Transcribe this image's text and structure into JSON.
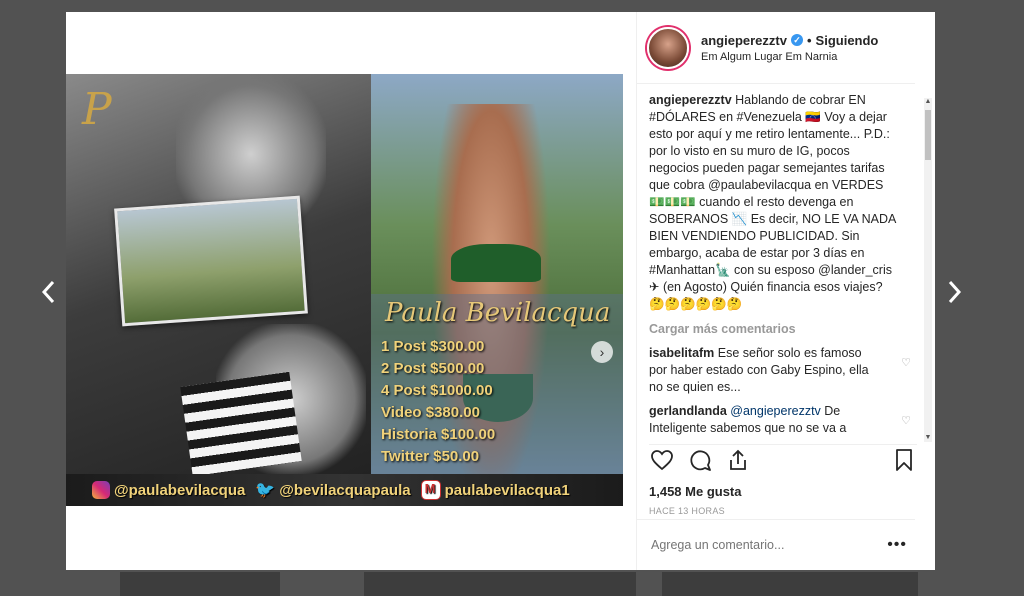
{
  "post": {
    "username": "angieperezztv",
    "follow_status": "Siguiendo",
    "location": "Em Algum Lugar Em Narnia"
  },
  "caption": {
    "author": "angieperezztv",
    "text": "Hablando de cobrar EN #DÓLARES en #Venezuela 🇻🇪 Voy a dejar esto por aquí y me retiro lentamente... P.D.: por lo visto en su muro de IG, pocos negocios pueden pagar semejantes tarifas que cobra @paulabevilacqua en VERDES 💵💵💵 cuando el resto devenga en SOBERANOS 📉 Es decir, NO LE VA NADA BIEN VENDIENDO PUBLICIDAD. Sin embargo, acaba de estar por 3 días en #Manhattan🗽 con su esposo @lander_cris ✈ (en Agosto) Quién financia esos viajes? 🤔🤔🤔🤔🤔🤔"
  },
  "load_more": "Cargar más comentarios",
  "comments": [
    {
      "author": "isabelitafm",
      "text": "Ese señor solo es famoso por haber estado con Gaby Espino, ella no se quien es..."
    },
    {
      "author": "gerlandlanda",
      "mention": "@angieperezztv",
      "text": "De Inteligente sabemos que no se va a"
    }
  ],
  "likes": "1,458 Me gusta",
  "time_ago": "HACE 13 HORAS",
  "add_comment_placeholder": "Agrega un comentario...",
  "image": {
    "monogram": "P",
    "name": "Paula Bevilacqua",
    "prices": [
      "1 Post $300.00",
      "2 Post $500.00",
      "4 Post $1000.00",
      "Video $380.00",
      "Historia $100.00",
      "Twitter $50.00"
    ],
    "social": {
      "instagram": "@paulabevilacqua",
      "twitter": "@bevilacquapaula",
      "email": "paulabevilacqua1"
    }
  },
  "icons": {
    "prev": "chevron-left-icon",
    "next": "chevron-right-icon",
    "like": "heart-icon",
    "comment": "comment-icon",
    "share": "share-icon",
    "save": "bookmark-icon",
    "more": "more-icon"
  },
  "colors": {
    "link": "#003569",
    "verified": "#3897f0",
    "text": "#262626",
    "muted": "#999999"
  }
}
